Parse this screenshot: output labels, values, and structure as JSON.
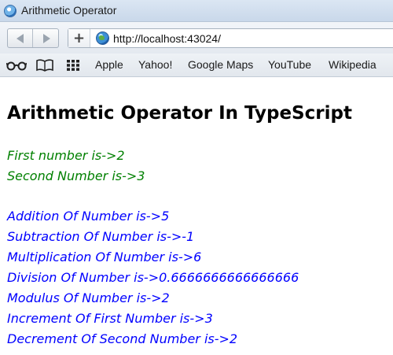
{
  "window": {
    "title": "Arithmetic Operator"
  },
  "toolbar": {
    "url": "http://localhost:43024/"
  },
  "bookmarks": {
    "items": [
      "Apple",
      "Yahoo!",
      "Google Maps",
      "YouTube",
      "Wikipedia"
    ]
  },
  "page": {
    "heading": "Arithmetic Operator In TypeScript",
    "inputs": [
      "First number is->2",
      "Second Number is->3"
    ],
    "results": [
      "Addition Of Number is->5",
      "Subtraction Of Number is->-1",
      "Multiplication Of Number is->6",
      "Division Of Number is->0.6666666666666666",
      "Modulus Of Number is->2",
      "Increment Of First Number is->3",
      "Decrement Of Second Number is->2"
    ]
  },
  "colors": {
    "input_text": "#008000",
    "result_text": "#0000ff"
  }
}
